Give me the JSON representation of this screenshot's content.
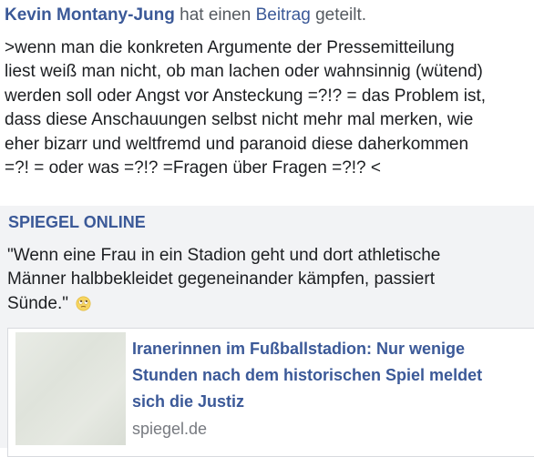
{
  "header": {
    "author": "Kevin Montany-Jung",
    "verb": "hat einen",
    "post_link": "Beitrag",
    "action": "geteilt."
  },
  "post": {
    "lines": [
      ">wenn man die konkreten Argumente der Pressemitteilung",
      "liest weiß man nicht, ob man lachen oder wahnsinnig (wütend)",
      "werden soll oder Angst vor Ansteckung =?!? = das Problem ist,",
      "dass diese Anschauungen selbst nicht mehr mal merken, wie",
      "eher bizarr und weltfremd und paranoid diese daherkommen",
      "=?! = oder was =?!? =Fragen über Fragen =?!? <"
    ]
  },
  "shared": {
    "source": "SPIEGEL ONLINE",
    "quote_lines": [
      "\"Wenn eine Frau in ein Stadion geht und dort athletische",
      "Männer halbbekleidet gegeneinander kämpfen, passiert",
      "Sünde.\""
    ],
    "emoji": "rolling-eyes-emoji",
    "card": {
      "title_lines": [
        "Iranerinnen im Fußballstadion: Nur wenige",
        "Stunden nach dem historischen Spiel meldet",
        "sich die Justiz"
      ],
      "domain": "spiegel.de"
    }
  },
  "colors": {
    "link": "#3b5998",
    "text": "#1c1e21",
    "muted": "#555a60",
    "share_bg": "#f2f3f5"
  }
}
